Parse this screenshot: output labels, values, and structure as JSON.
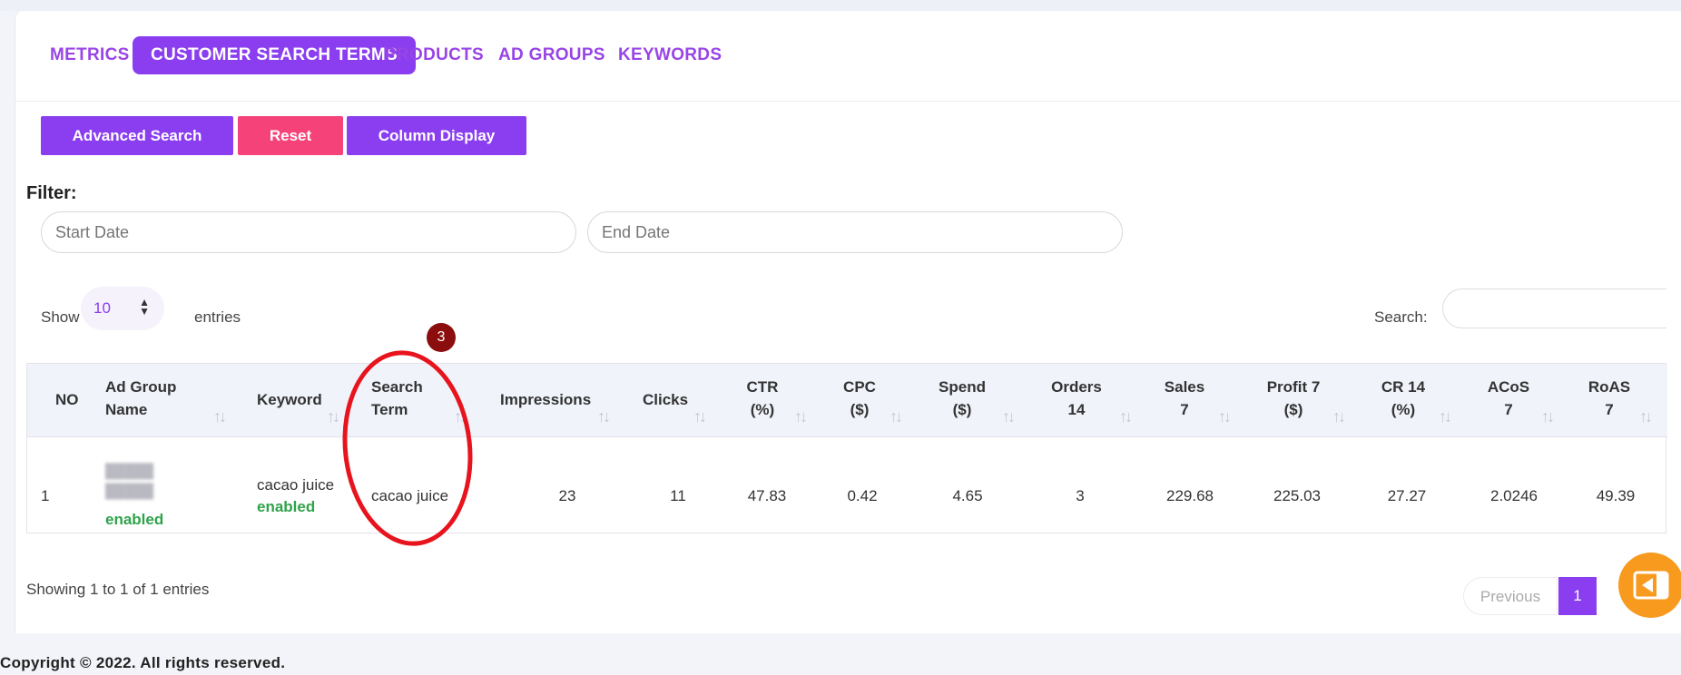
{
  "tabs": [
    {
      "label": "METRICS"
    },
    {
      "label": "CUSTOMER SEARCH TERMS"
    },
    {
      "label": "PRODUCTS"
    },
    {
      "label": "AD GROUPS"
    },
    {
      "label": "KEYWORDS"
    }
  ],
  "active_tab": "CUSTOMER SEARCH TERMS",
  "buttons": {
    "advanced_search": "Advanced Search",
    "reset": "Reset",
    "column_display": "Column Display"
  },
  "filter": {
    "label": "Filter:",
    "start_placeholder": "Start Date",
    "end_placeholder": "End Date"
  },
  "length": {
    "show": "Show",
    "value": "10",
    "entries": "entries"
  },
  "search": {
    "label": "Search:"
  },
  "table": {
    "headers": {
      "no": "NO",
      "ad_group_1": "Ad Group",
      "ad_group_2": "Name",
      "keyword": "Keyword",
      "search_1": "Search",
      "search_2": "Term",
      "impressions": "Impressions",
      "clicks": "Clicks",
      "ctr_1": "CTR",
      "ctr_2": "(%)",
      "cpc_1": "CPC",
      "cpc_2": "($)",
      "spend_1": "Spend",
      "spend_2": "($)",
      "orders_1": "Orders",
      "orders_2": "14",
      "sales_1": "Sales",
      "sales_2": "7",
      "profit_1": "Profit 7",
      "profit_2": "($)",
      "cr_1": "CR 14",
      "cr_2": "(%)",
      "acos_1": "ACoS",
      "acos_2": "7",
      "roas_1": "RoAS",
      "roas_2": "7"
    },
    "row": {
      "no": "1",
      "ad_group_blur_1": "█████",
      "ad_group_blur_2": "█████",
      "ad_group_status": "enabled",
      "keyword": "cacao juice",
      "keyword_status": "enabled",
      "search_term": "cacao juice",
      "impressions": "23",
      "clicks": "11",
      "ctr": "47.83",
      "cpc": "0.42",
      "spend": "4.65",
      "orders": "3",
      "sales": "229.68",
      "profit": "225.03",
      "cr": "27.27",
      "acos": "2.0246",
      "roas": "49.39"
    }
  },
  "info": {
    "prefix": "Showing ",
    "from": "1",
    "to_word": " to ",
    "to": "1",
    "of_word": " of ",
    "total": "1",
    "suffix": " entries"
  },
  "pagination": {
    "previous": "Previous",
    "page": "1"
  },
  "annotation_badge": "3",
  "copyright": "Copyright © 2022. All rights reserved.",
  "colors": {
    "accent": "#8a3ef0",
    "reset": "#f5437a",
    "enabled": "#2fa24a",
    "float_button": "#f79a1e",
    "annotation": "#e8141d"
  },
  "icons": {
    "sort": "sort-arrows-icon",
    "select_arrows": "select-arrows-icon",
    "float": "sidebar-toggle-icon"
  }
}
